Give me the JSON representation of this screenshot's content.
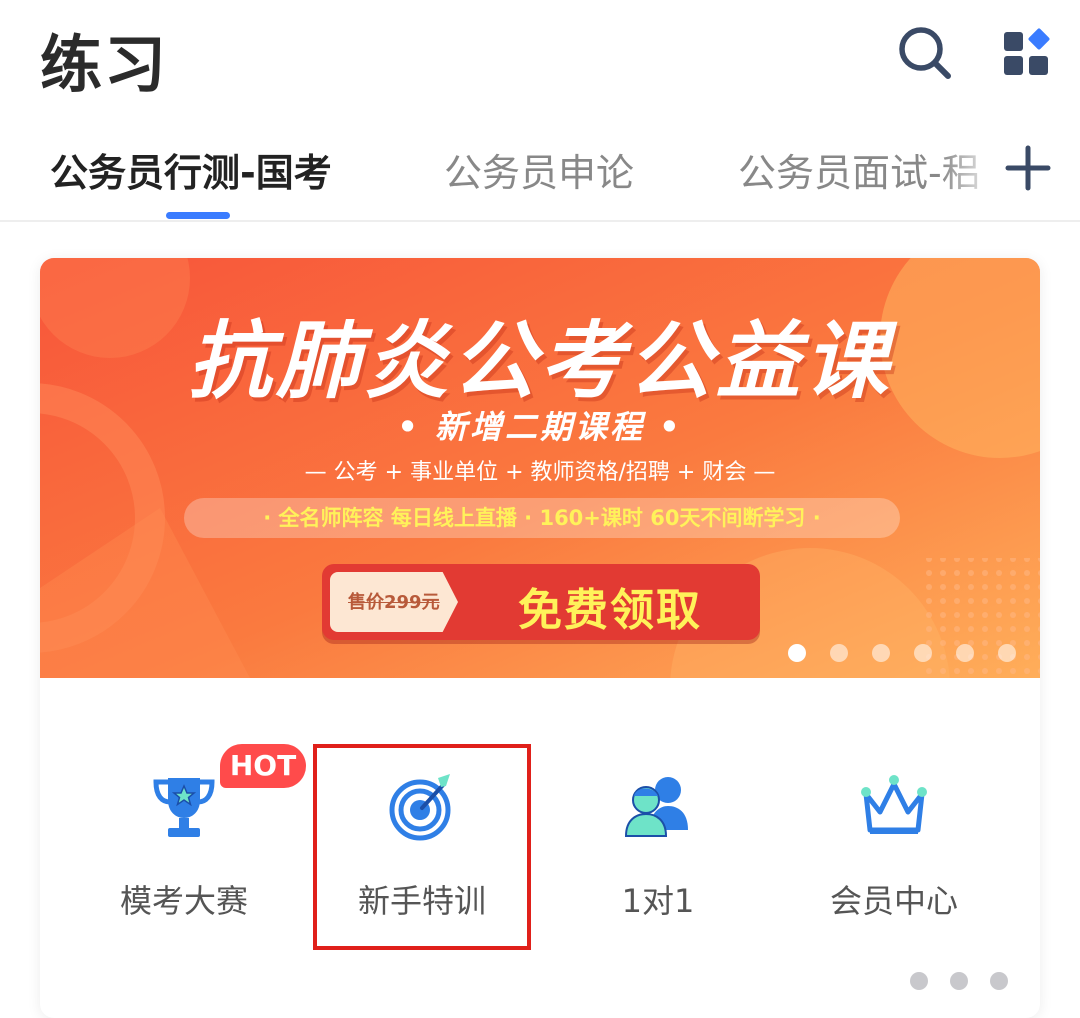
{
  "header": {
    "title": "练习",
    "search_icon": "search-icon",
    "apps_icon": "grid-apps-icon"
  },
  "tabs": [
    {
      "label": "公务员行测-国考",
      "active": true
    },
    {
      "label": "公务员申论",
      "active": false
    },
    {
      "label": "公务员面试-稆",
      "active": false
    }
  ],
  "add_tab_icon": "plus-icon",
  "banner": {
    "headline": "抗肺炎公考公益课",
    "sub_headline": "• 新增二期课程 •",
    "categories": "— 公考 + 事业单位 + 教师资格/招聘 + 财会 —",
    "features": "· 全名师阵容 每日线上直播 · 160+课时 60天不间断学习 ·",
    "original_price": "售价299元",
    "cta": "免费领取",
    "carousel_count": 6,
    "carousel_active": 0
  },
  "shortcuts": [
    {
      "label": "模考大赛",
      "icon": "trophy-icon",
      "badge": "HOT"
    },
    {
      "label": "新手特训",
      "icon": "target-icon"
    },
    {
      "label": "1对1",
      "icon": "tutor-users-icon"
    },
    {
      "label": "会员中心",
      "icon": "crown-icon"
    }
  ],
  "shortcut_pages": {
    "count": 3,
    "active": 0
  },
  "colors": {
    "accent": "#3a7cff",
    "banner_orange": "#ff6a3d",
    "cta_red": "#e8453c",
    "highlight": "#e0201a",
    "hot": "#ff4b4b",
    "icon_blue": "#2f7fe6"
  }
}
